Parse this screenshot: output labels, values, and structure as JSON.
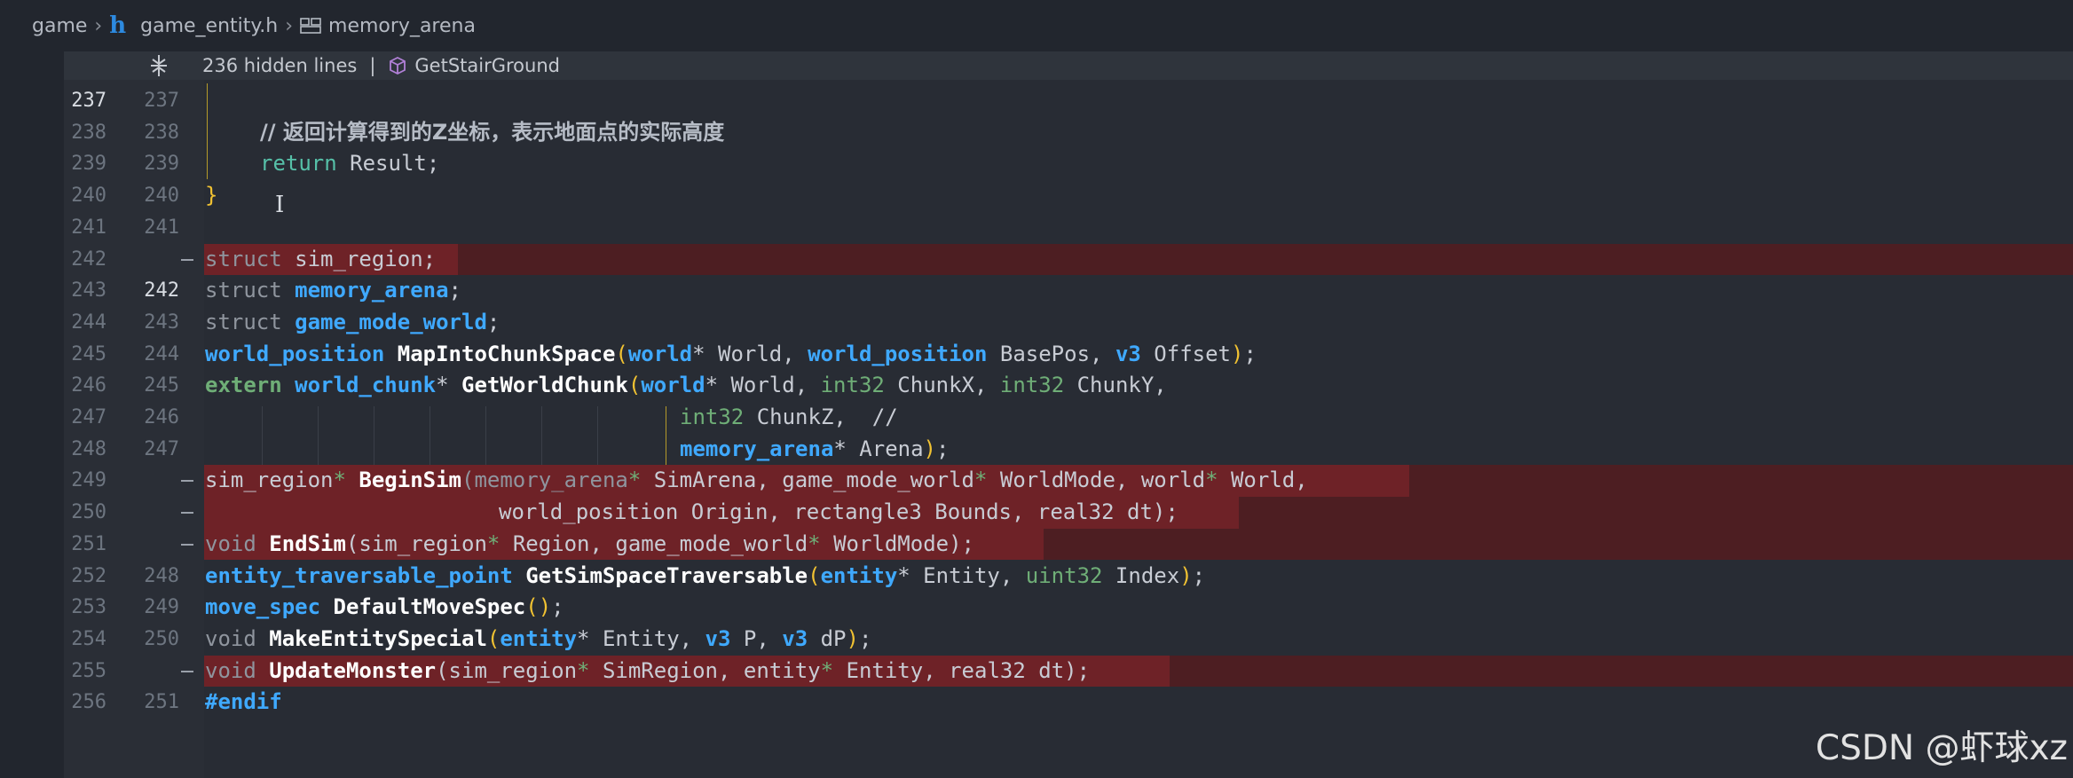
{
  "breadcrumb": {
    "folder": "game",
    "file_icon": "h",
    "file": "game_entity.h",
    "symbol": "memory_arena"
  },
  "hidden_bar": {
    "count_label": "236 hidden lines",
    "separator": "|",
    "symbol": "GetStairGround"
  },
  "lines": [
    {
      "old": "237",
      "new": "237",
      "current": true,
      "kind": "ctx"
    },
    {
      "old": "238",
      "new": "238",
      "kind": "ctx",
      "comment_prefix": "// ",
      "comment": "返回计算得到的Z坐标，表示地面点的实际高度"
    },
    {
      "old": "239",
      "new": "239",
      "kind": "ctx",
      "kw": "return",
      "rest": " Result;"
    },
    {
      "old": "240",
      "new": "240",
      "kind": "ctx",
      "brace": "}"
    },
    {
      "old": "241",
      "new": "241",
      "kind": "ctx"
    },
    {
      "old": "242",
      "new": "",
      "kind": "del",
      "t1": "struct",
      "t2": " sim_region;"
    },
    {
      "old": "243",
      "new": "242",
      "kind": "ctx",
      "t1": "struct ",
      "t2": "memory_arena",
      "t3": ";"
    },
    {
      "old": "244",
      "new": "243",
      "kind": "ctx",
      "t1": "struct ",
      "t2": "game_mode_world",
      "t3": ";"
    },
    {
      "old": "245",
      "new": "244",
      "kind": "ctx",
      "a": "world_position",
      "b": " ",
      "fn": "MapIntoChunkSpace",
      "p1": "(",
      "c": "world",
      "d": "* World, ",
      "e": "world_position",
      "f": " BasePos, ",
      "g": "v3",
      "h": " Offset",
      "p2": ")",
      "i": ";"
    },
    {
      "old": "246",
      "new": "245",
      "kind": "ctx",
      "a": "extern",
      "b": " ",
      "c": "world_chunk",
      "d": "* ",
      "fn": "GetWorldChunk",
      "p1": "(",
      "e": "world",
      "f": "* World, ",
      "g": "int32",
      "h": " ChunkX, ",
      "i": "int32",
      "j": " ChunkY,"
    },
    {
      "old": "247",
      "new": "246",
      "kind": "ctx",
      "a": "int32",
      "b": " ChunkZ,  //"
    },
    {
      "old": "248",
      "new": "247",
      "kind": "ctx",
      "a": "memory_arena",
      "b": "* Arena",
      "p2": ")",
      "c": ";"
    },
    {
      "old": "249",
      "new": "",
      "kind": "del",
      "a": "sim_region",
      "b": "* ",
      "fn": "BeginSim",
      "c": "(memory_arena",
      "d": "* ",
      "e": "SimArena, game_mode_world",
      "f": "* ",
      "g": "WorldMode, world",
      "h": "* ",
      "i": "World,"
    },
    {
      "old": "250",
      "new": "",
      "kind": "del",
      "a": "world_position Origin, rectangle3 Bounds, real32 dt);"
    },
    {
      "old": "251",
      "new": "",
      "kind": "del",
      "a": "void",
      "b": " ",
      "fn": "EndSim",
      "c": "(sim_region",
      "d": "* ",
      "e": "Region, game_mode_world",
      "f": "* ",
      "g": "WorldMode);"
    },
    {
      "old": "252",
      "new": "248",
      "kind": "ctx",
      "a": "entity_traversable_point",
      "b": " ",
      "fn": "GetSimSpaceTraversable",
      "p1": "(",
      "c": "entity",
      "d": "* Entity, ",
      "e": "uint32",
      "f": " Index",
      "p2": ")",
      "g": ";"
    },
    {
      "old": "253",
      "new": "249",
      "kind": "ctx",
      "a": "move_spec",
      "b": " ",
      "fn": "DefaultMoveSpec",
      "p1": "()",
      "c": ";"
    },
    {
      "old": "254",
      "new": "250",
      "kind": "ctx",
      "a": "void",
      "b": " ",
      "fn": "MakeEntitySpecial",
      "p1": "(",
      "c": "entity",
      "d": "* Entity, ",
      "e": "v3",
      "f": " P, ",
      "g": "v3",
      "h": " dP",
      "p2": ")",
      "i": ";"
    },
    {
      "old": "255",
      "new": "",
      "kind": "del",
      "a": "void",
      "b": " ",
      "fn": "UpdateMonster",
      "c": "(sim_region",
      "d": "* ",
      "e": "SimRegion, entity",
      "f": "* ",
      "g": "Entity, real32 dt);"
    },
    {
      "old": "256",
      "new": "251",
      "kind": "ctx",
      "a": "#endif"
    }
  ],
  "watermark": "CSDN @虾球xz"
}
